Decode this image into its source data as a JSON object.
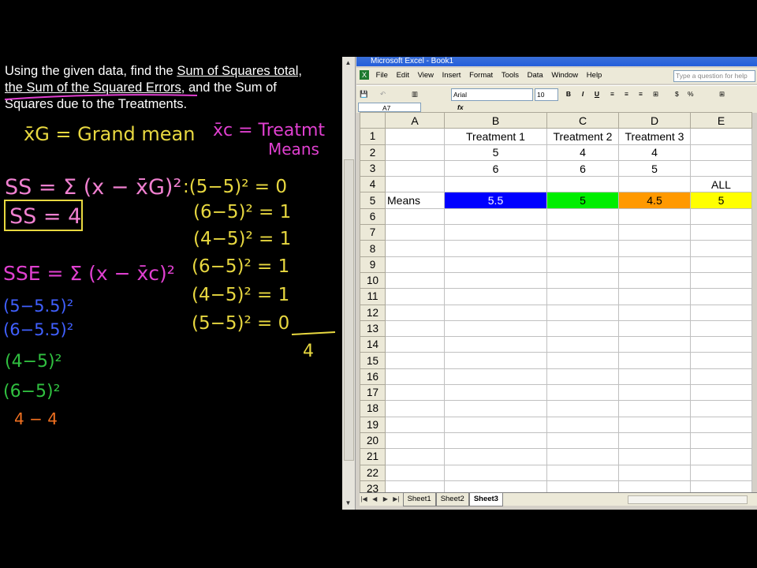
{
  "problem": {
    "line1_pre": "Using the given data, find the ",
    "line1_link": "Sum of Squares total,",
    "line2_link": "the Sum of the Squared Errors",
    "line2_post": ", and the Sum of",
    "line3": "Squares due to the Treatments."
  },
  "handwriting": {
    "grand_mean_def": "x̄G = Grand mean",
    "treat_means_def1": "x̄c = Treatmt",
    "treat_means_def2": "Means",
    "ss_formula": "SS = Σ (x − x̄G)²",
    "ss_result": "SS = 4",
    "sst_terms": [
      ":(5−5)² = 0",
      "(6−5)² = 1",
      "(4−5)² = 1",
      "(6−5)² = 1",
      "(4−5)² = 1",
      "(5−5)² = 0"
    ],
    "sst_sum": "4",
    "sse_formula": "SSE = Σ (x − x̄c)²",
    "sse_terms_magenta": [
      "(5−5.5)²",
      "(6−5.5)²"
    ],
    "sse_terms_green": [
      "(4−5)²",
      "(6−5)²"
    ],
    "sse_orange": "4 − 4",
    "colors": {
      "yellow": "#e8d840",
      "magenta": "#e040d0",
      "green": "#30c040",
      "blue": "#4060ff",
      "orange": "#f07020",
      "pink": "#f080d0"
    }
  },
  "excel": {
    "title": "Microsoft Excel - Book1",
    "menus": [
      "File",
      "Edit",
      "View",
      "Insert",
      "Format",
      "Tools",
      "Data",
      "Window",
      "Help"
    ],
    "help_placeholder": "Type a question for help",
    "font_name": "Arial",
    "font_size": "10",
    "format_buttons": [
      "B",
      "I",
      "U"
    ],
    "name_box": "A7",
    "fx": "fx",
    "columns": [
      "A",
      "B",
      "C",
      "D",
      "E"
    ],
    "rows": [
      {
        "n": "1",
        "cells": [
          "",
          "Treatment 1",
          "Treatment 2",
          "Treatment 3",
          ""
        ]
      },
      {
        "n": "2",
        "cells": [
          "",
          "5",
          "4",
          "4",
          ""
        ]
      },
      {
        "n": "3",
        "cells": [
          "",
          "6",
          "6",
          "5",
          ""
        ]
      },
      {
        "n": "4",
        "cells": [
          "",
          "",
          "",
          "",
          "ALL"
        ]
      },
      {
        "n": "5",
        "cells": [
          "Means",
          "5.5",
          "5",
          "4.5",
          "5"
        ]
      },
      {
        "n": "6",
        "cells": [
          "",
          "",
          "",
          "",
          ""
        ]
      },
      {
        "n": "7",
        "cells": [
          "",
          "",
          "",
          "",
          ""
        ]
      },
      {
        "n": "8",
        "cells": [
          "",
          "",
          "",
          "",
          ""
        ]
      },
      {
        "n": "9",
        "cells": [
          "",
          "",
          "",
          "",
          ""
        ]
      },
      {
        "n": "10",
        "cells": [
          "",
          "",
          "",
          "",
          ""
        ]
      },
      {
        "n": "11",
        "cells": [
          "",
          "",
          "",
          "",
          ""
        ]
      },
      {
        "n": "12",
        "cells": [
          "",
          "",
          "",
          "",
          ""
        ]
      },
      {
        "n": "13",
        "cells": [
          "",
          "",
          "",
          "",
          ""
        ]
      },
      {
        "n": "14",
        "cells": [
          "",
          "",
          "",
          "",
          ""
        ]
      },
      {
        "n": "15",
        "cells": [
          "",
          "",
          "",
          "",
          ""
        ]
      },
      {
        "n": "16",
        "cells": [
          "",
          "",
          "",
          "",
          ""
        ]
      },
      {
        "n": "17",
        "cells": [
          "",
          "",
          "",
          "",
          ""
        ]
      },
      {
        "n": "18",
        "cells": [
          "",
          "",
          "",
          "",
          ""
        ]
      },
      {
        "n": "19",
        "cells": [
          "",
          "",
          "",
          "",
          ""
        ]
      },
      {
        "n": "20",
        "cells": [
          "",
          "",
          "",
          "",
          ""
        ]
      },
      {
        "n": "21",
        "cells": [
          "",
          "",
          "",
          "",
          ""
        ]
      },
      {
        "n": "22",
        "cells": [
          "",
          "",
          "",
          "",
          ""
        ]
      },
      {
        "n": "23",
        "cells": [
          "",
          "",
          "",
          "",
          ""
        ]
      }
    ],
    "mean_fill_colors": [
      "#0000ff",
      "#00ee00",
      "#ff9900",
      "#ffff00"
    ],
    "sheet_tabs": [
      "Sheet1",
      "Sheet2",
      "Sheet3"
    ],
    "active_sheet": "Sheet3"
  }
}
